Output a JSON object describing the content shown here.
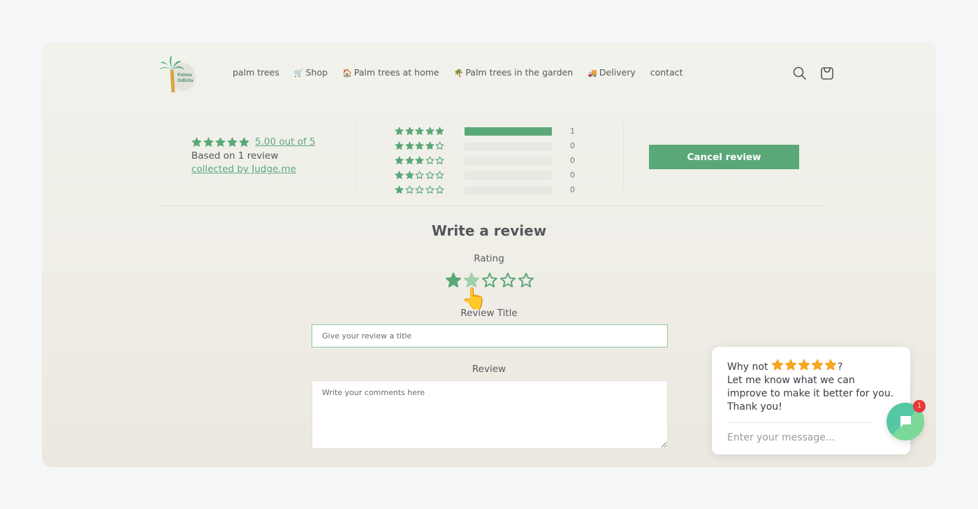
{
  "header": {
    "logo_text": [
      "Palma",
      "Odbita"
    ],
    "nav": [
      {
        "icon": "",
        "label": "palm trees"
      },
      {
        "icon": "🛒",
        "label": "Shop"
      },
      {
        "icon": "🏠",
        "label": "Palm trees at home"
      },
      {
        "icon": "🌴",
        "label": "Palm trees in the garden"
      },
      {
        "icon": "🚚",
        "label": "Delivery"
      },
      {
        "icon": "",
        "label": "contact"
      }
    ],
    "icons": [
      "search-icon",
      "cart-icon"
    ]
  },
  "summary": {
    "average_stars": 5,
    "average_label": "5.00 out of 5",
    "based_on": "Based on 1 review",
    "collected_by": "collected by Judge.me",
    "histogram": [
      {
        "stars": 5,
        "count": "1",
        "fraction": 1.0
      },
      {
        "stars": 4,
        "count": "0",
        "fraction": 0
      },
      {
        "stars": 3,
        "count": "0",
        "fraction": 0
      },
      {
        "stars": 2,
        "count": "0",
        "fraction": 0
      },
      {
        "stars": 1,
        "count": "0",
        "fraction": 0
      }
    ],
    "cancel_label": "Cancel review"
  },
  "form": {
    "title": "Write a review",
    "rating_label": "Rating",
    "rating_selected": 1,
    "rating_hover": 2,
    "review_title_label": "Review Title",
    "review_title_placeholder": "Give your review a title",
    "review_title_value": "",
    "review_label": "Review",
    "review_placeholder": "Write your comments here",
    "review_value": ""
  },
  "chat": {
    "line1_prefix": "Why not",
    "line1_suffix": "?",
    "star_count": 5,
    "body": "Let me know what we can improve to make it better for you. Thank you!",
    "input_placeholder": "Enter your message...",
    "badge_count": "1"
  },
  "colors": {
    "accent": "#5aa877",
    "chat_star": "#f5a623",
    "badge": "#e8363c"
  }
}
